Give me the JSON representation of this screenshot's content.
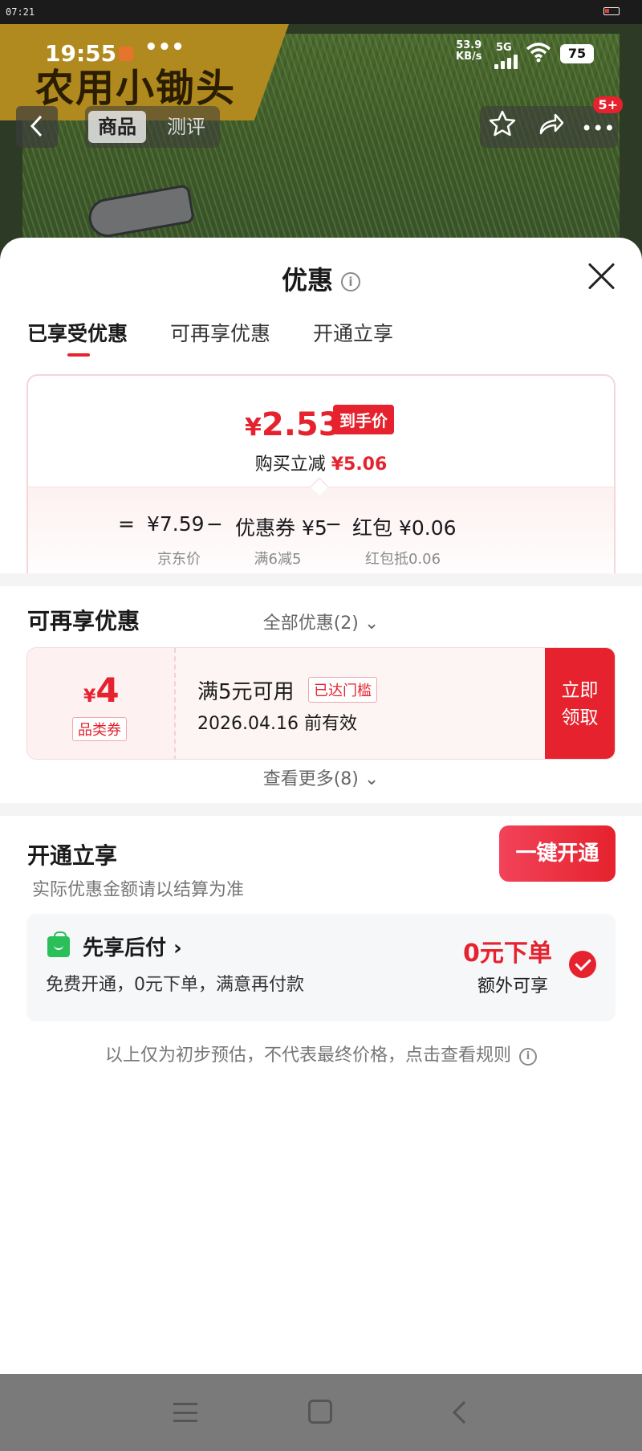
{
  "system_bar": {
    "time": "07:21"
  },
  "product_image": {
    "banner_text": "农用小锄头",
    "status": {
      "time": "19:55",
      "more": "•••",
      "speed": "53.9\nKB/s",
      "network": "5G",
      "battery": "75"
    },
    "nav": {
      "tab_product": "商品",
      "tab_review": "测评",
      "badge": "5+",
      "more": "•••"
    }
  },
  "sheet": {
    "title": "优惠",
    "tabs": [
      "已享受优惠",
      "可再享优惠",
      "开通立享"
    ],
    "price_card": {
      "currency": "¥",
      "price": "2.53",
      "final_tag": "到手价",
      "instant_label": "购买立减",
      "instant_value": "¥5.06",
      "eq": "=",
      "minus1": "−",
      "minus2": "−",
      "jd_price": "¥7.59",
      "jd_label": "京东价",
      "coupon_value": "优惠券 ¥5",
      "coupon_label": "满6减5",
      "redpacket_value": "红包 ¥0.06",
      "redpacket_label": "红包抵0.06"
    },
    "all_offers": "全部优惠(2) ⌄",
    "more_offers": {
      "title": "可再享优惠",
      "coupon": {
        "currency": "¥",
        "value": "4",
        "type": "品类券",
        "condition": "满5元可用",
        "status": "已达门槛",
        "validity": "2026.04.16 前有效",
        "claim_line1": "立即",
        "claim_line2": "领取"
      },
      "see_more": "查看更多(8) ⌄"
    },
    "activate": {
      "title": "开通立享",
      "subtitle": "实际优惠金额请以结算为准",
      "button": "一键开通",
      "pay_later": {
        "title": "先享后付 ›",
        "desc": "免费开通，0元下单，满意再付款",
        "price": "0元下单",
        "extra": "额外可享"
      }
    },
    "disclaimer": "以上仅为初步预估，不代表最终价格，点击查看规则"
  }
}
